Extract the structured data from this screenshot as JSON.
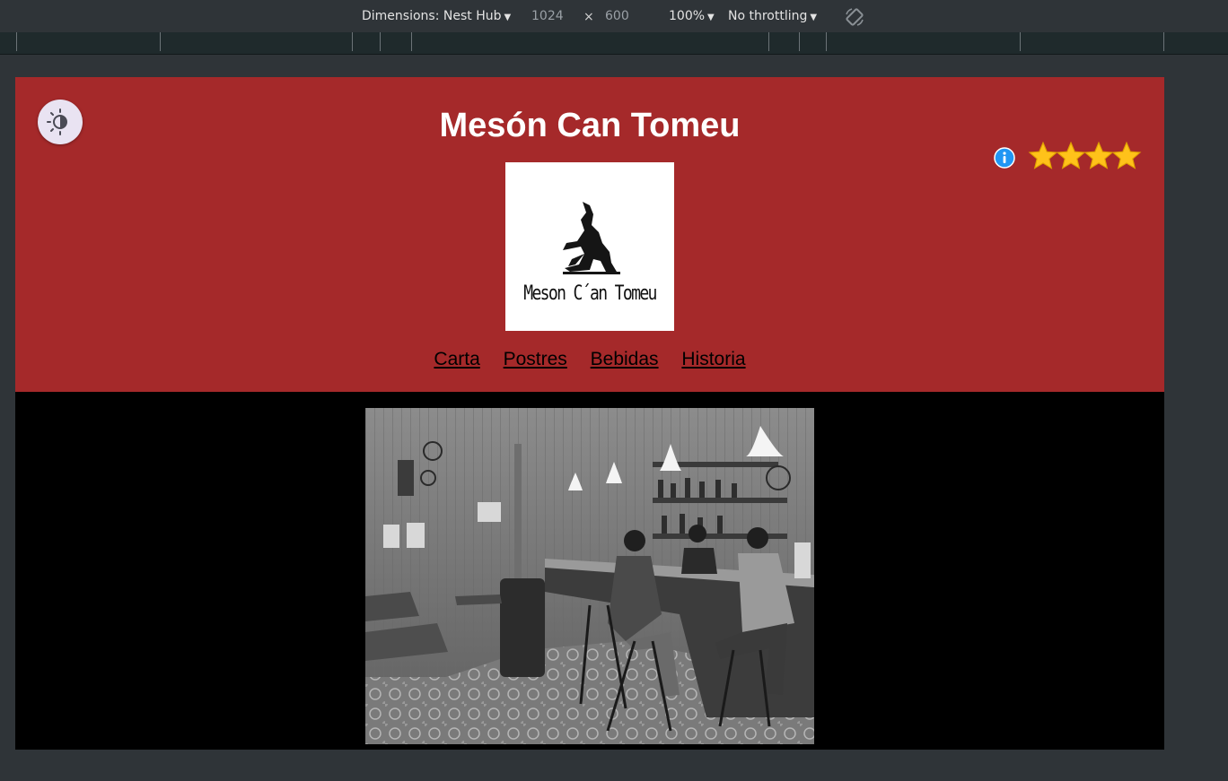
{
  "devtools": {
    "dimensions_label": "Dimensions: Nest Hub",
    "width": "1024",
    "times": "×",
    "height": "600",
    "zoom": "100%",
    "throttling": "No throttling",
    "rotate_icon": "rotate-icon",
    "caret_icon": "caret-down-icon"
  },
  "site": {
    "title": "Mesón Can Tomeu",
    "logo_text": "Meson C´an Tomeu",
    "nav": [
      "Carta",
      "Postres",
      "Bebidas",
      "Historia"
    ],
    "theme_toggle_icon": "theme-toggle-icon",
    "info_icon": "info-icon",
    "rating": 4,
    "rating_max": 4
  },
  "colors": {
    "header_bg": "#a5292a",
    "page_bg": "#000000",
    "star": "#ffc21a",
    "info": "#2196f3"
  }
}
